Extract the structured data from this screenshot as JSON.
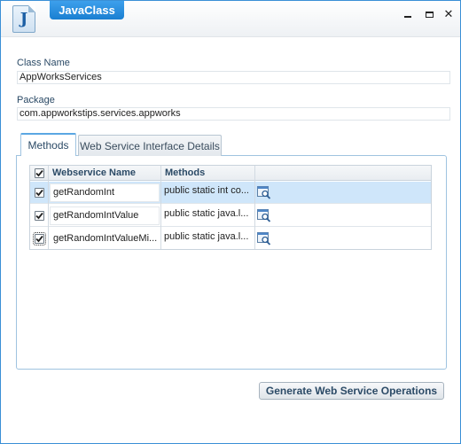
{
  "window": {
    "title": "JavaClass",
    "app_icon_letter": "J",
    "controls": {
      "minimize": "minimize-icon",
      "maximize": "maximize-icon",
      "close": "✕"
    }
  },
  "form": {
    "class_name_label": "Class Name",
    "class_name_value": "AppWorksServices",
    "package_label": "Package",
    "package_value": "com.appworkstips.services.appworks"
  },
  "tabs": [
    {
      "label": "Methods",
      "active": true
    },
    {
      "label": "Web Service Interface Details",
      "active": false
    }
  ],
  "grid": {
    "headers": {
      "check_all": true,
      "name": "Webservice Name",
      "methods": "Methods"
    },
    "rows": [
      {
        "checked": true,
        "name": "getRandomInt",
        "method": "public static int co...",
        "icon": "inspect-icon",
        "selected": true
      },
      {
        "checked": true,
        "name": "getRandomIntValue",
        "method": "public static java.l...",
        "icon": "inspect-icon",
        "selected": false
      },
      {
        "checked": true,
        "name": "getRandomIntValueMi...",
        "method": "public static java.l...",
        "icon": "inspect-icon",
        "selected": false
      }
    ]
  },
  "actions": {
    "generate_label": "Generate Web Service Operations"
  },
  "colors": {
    "accent": "#1a7fd1",
    "selected_row": "#cfe6fa",
    "border": "#3a8fd6"
  }
}
